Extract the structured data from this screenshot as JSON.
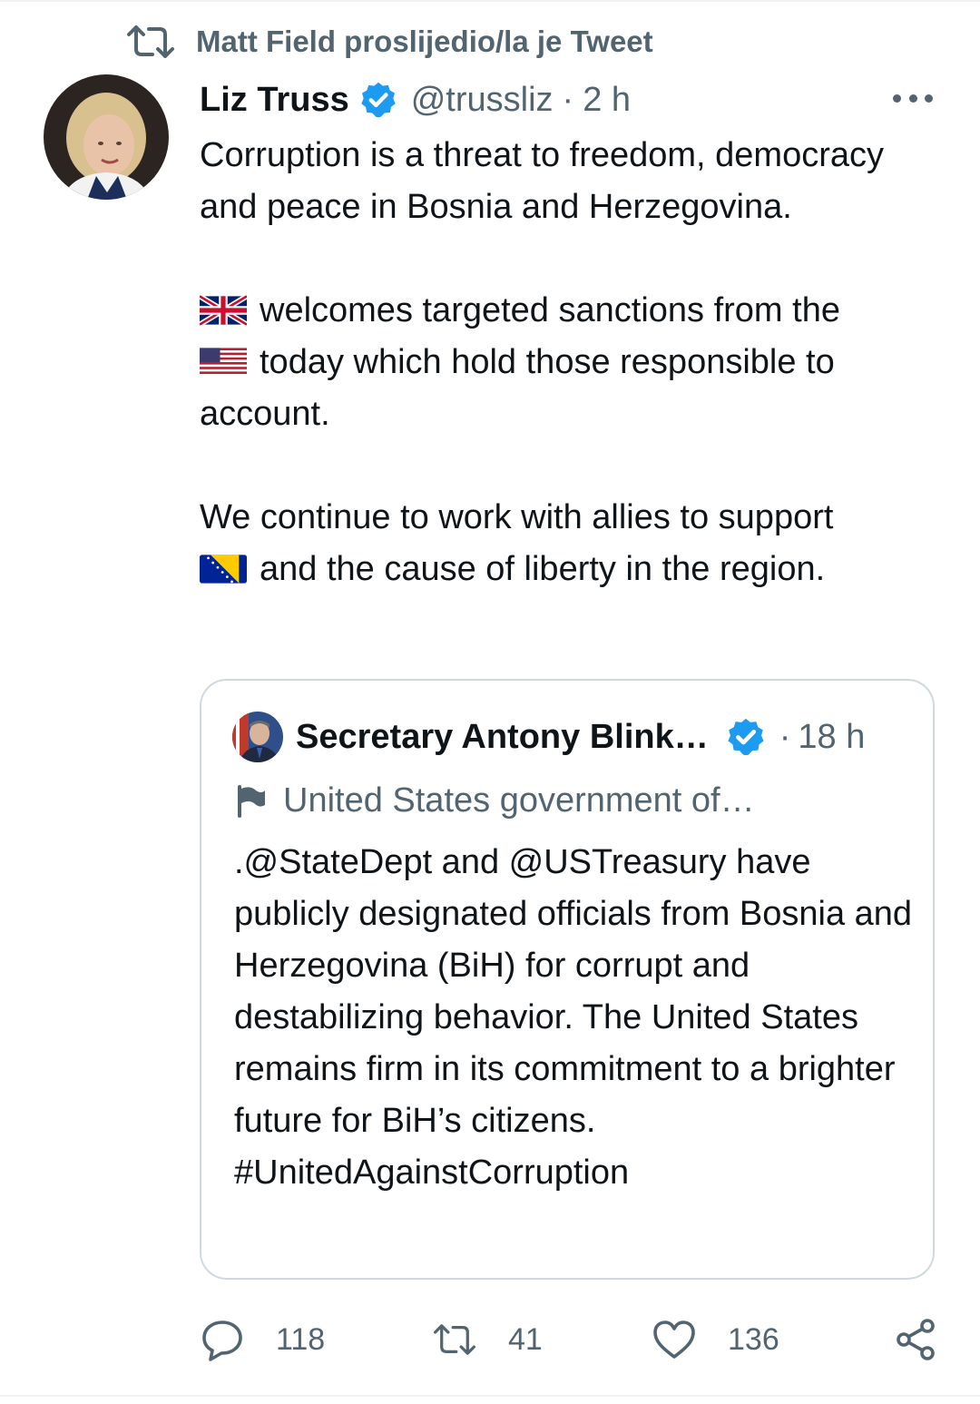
{
  "retweet_context": {
    "text": "Matt Field proslijedio/la je Tweet",
    "icon": "retweet-icon"
  },
  "tweet": {
    "author_name": "Liz Truss",
    "handle": "@trussliz",
    "separator": "·",
    "time": "2 h",
    "verified": true,
    "text": {
      "p1": "Corruption is a threat to freedom, democracy and peace in Bosnia and Herzegovina.",
      "p2a": "welcomes targeted sanctions from the",
      "p2b": "today which hold those responsible to account.",
      "p3a": "We continue to work with allies to support",
      "p3b": "and the cause of liberty in the region."
    },
    "emoji": {
      "uk": "flag-uk-icon",
      "us": "flag-us-icon",
      "bih": "flag-bosnia-icon"
    }
  },
  "quote": {
    "author_name": "Secretary Antony Blink…",
    "separator": "·",
    "time": "18 h",
    "verified": true,
    "label": "United States government of…",
    "text": ".@StateDept and @USTreasury have publicly designated officials from Bosnia and Herzegovina (BiH) for corrupt and destabilizing behavior. The United States remains firm in its commitment to a brighter future for BiH’s citizens. #UnitedAgainstCorruption"
  },
  "actions": {
    "replies": "118",
    "retweets": "41",
    "likes": "136"
  },
  "colors": {
    "text": "#0f1419",
    "secondary": "#536471",
    "verified": "#1d9bf0",
    "border": "#cfd9de"
  }
}
